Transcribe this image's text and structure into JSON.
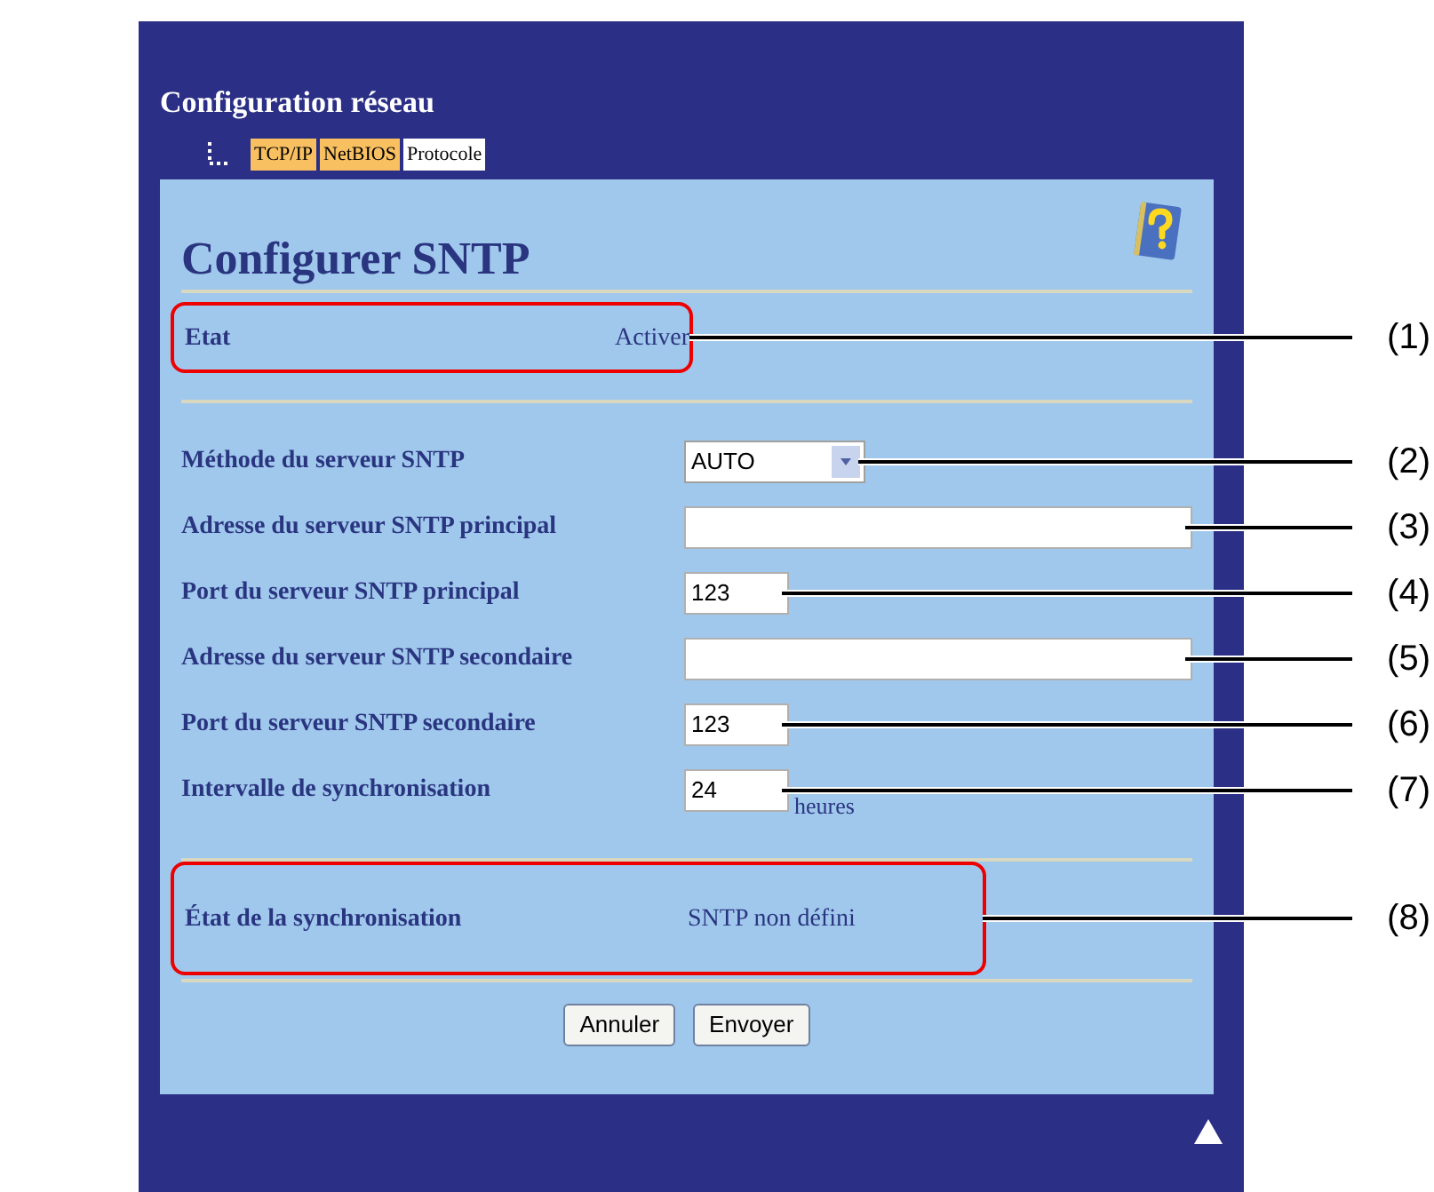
{
  "page_title": "Configuration réseau",
  "tabs": [
    {
      "label": "TCP/IP",
      "selected": false
    },
    {
      "label": "NetBIOS",
      "selected": false
    },
    {
      "label": "Protocole",
      "selected": true
    }
  ],
  "heading": "Configurer SNTP",
  "status": {
    "label": "Etat",
    "value": "Activer",
    "highlighted": true,
    "callout": "(1)"
  },
  "settings": [
    {
      "label": "Méthode du serveur SNTP",
      "kind": "select",
      "value": "AUTO",
      "callout": "(2)"
    },
    {
      "label": "Adresse du serveur SNTP principal",
      "kind": "wide",
      "callout": "(3)"
    },
    {
      "label": "Port du serveur SNTP principal",
      "kind": "short",
      "value": "123",
      "callout": "(4)"
    },
    {
      "label": "Adresse du serveur SNTP secondaire",
      "kind": "wide",
      "callout": "(5)"
    },
    {
      "label": "Port du serveur SNTP secondaire",
      "kind": "short",
      "value": "123",
      "callout": "(6)"
    },
    {
      "label": "Intervalle de synchronisation",
      "kind": "short",
      "value": "24",
      "unit": "heures",
      "callout": "(7)"
    }
  ],
  "sync": {
    "label": "État de la synchronisation",
    "value": "SNTP non défini",
    "highlighted": true,
    "callout": "(8)"
  },
  "buttons": [
    "Annuler",
    "Envoyer"
  ]
}
